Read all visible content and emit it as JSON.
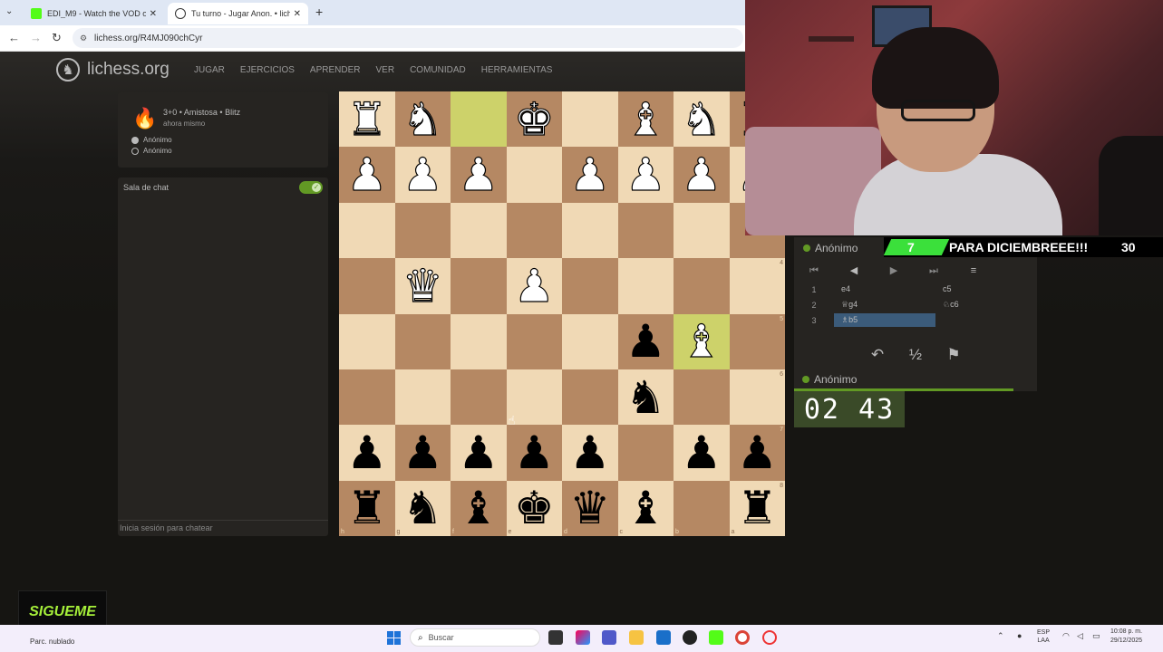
{
  "browser": {
    "tabs": [
      {
        "title": "EDI_M9 - Watch the VOD on Ki",
        "close": "✕"
      },
      {
        "title": "Tu turno - Jugar Anon. • liches",
        "close": "✕"
      }
    ],
    "new_tab": "+",
    "url": "lichess.org/R4MJ090chCyr"
  },
  "site": {
    "logo": "lichess.org",
    "nav": [
      "JUGAR",
      "EJERCICIOS",
      "APRENDER",
      "VER",
      "COMUNIDAD",
      "HERRAMIENTAS"
    ]
  },
  "game_info": {
    "setup": "3+0 • Amistosa • Blitz",
    "time": "ahora mismo",
    "players": [
      "Anónimo",
      "Anónimo"
    ]
  },
  "chat": {
    "title": "Sala de chat",
    "toggle_on": true,
    "login_hint": "Inicia sesión para chatear"
  },
  "board": {
    "orientation": "black",
    "rank_labels": [
      "",
      "",
      "",
      "4",
      "5",
      "6",
      "7",
      "8"
    ],
    "file_labels": [
      "h",
      "g",
      "f",
      "e",
      "d",
      "c",
      "b",
      "a"
    ],
    "rows": [
      [
        "wR",
        "wN",
        "",
        "wK",
        "",
        "wB",
        "wN",
        "wR"
      ],
      [
        "wP",
        "wP",
        "wP",
        "",
        "wP",
        "wP",
        "wP",
        "wP"
      ],
      [
        "",
        "",
        "",
        "",
        "",
        "",
        "",
        ""
      ],
      [
        "",
        "wQ",
        "",
        "wP",
        "",
        "",
        "",
        ""
      ],
      [
        "",
        "",
        "",
        "",
        "",
        "bP",
        "wB",
        ""
      ],
      [
        "",
        "",
        "",
        "",
        "",
        "bN",
        "",
        ""
      ],
      [
        "bP",
        "bP",
        "bP",
        "bP",
        "bP",
        "",
        "bP",
        "bP"
      ],
      [
        "bR",
        "bN",
        "bB",
        "bK",
        "bQ",
        "bB",
        "",
        "bR"
      ]
    ],
    "highlights": [
      [
        0,
        2
      ],
      [
        4,
        6
      ]
    ]
  },
  "overlay": {
    "counter": "7",
    "goal": "PARA DICIEMBREEE!!!",
    "target": "30",
    "follow": "SIGUEME"
  },
  "game_panel": {
    "opponent": "Anónimo",
    "controls": [
      "⏮",
      "◀",
      "▶",
      "⏭",
      "≡"
    ],
    "moves": [
      {
        "n": "1",
        "white": "e4",
        "black": "c5"
      },
      {
        "n": "2",
        "white": "♕g4",
        "black": "♘c6"
      },
      {
        "n": "3",
        "white": "♗b5",
        "black": ""
      }
    ],
    "actions": [
      "↶",
      "½",
      "⚑"
    ],
    "player": "Anónimo",
    "clock": "02 43"
  },
  "taskbar": {
    "weather": "Parc. nublado",
    "search": "Buscar",
    "lang": [
      "ESP",
      "LAA"
    ],
    "time": "10:08 p. m.",
    "date": "29/12/2025"
  }
}
